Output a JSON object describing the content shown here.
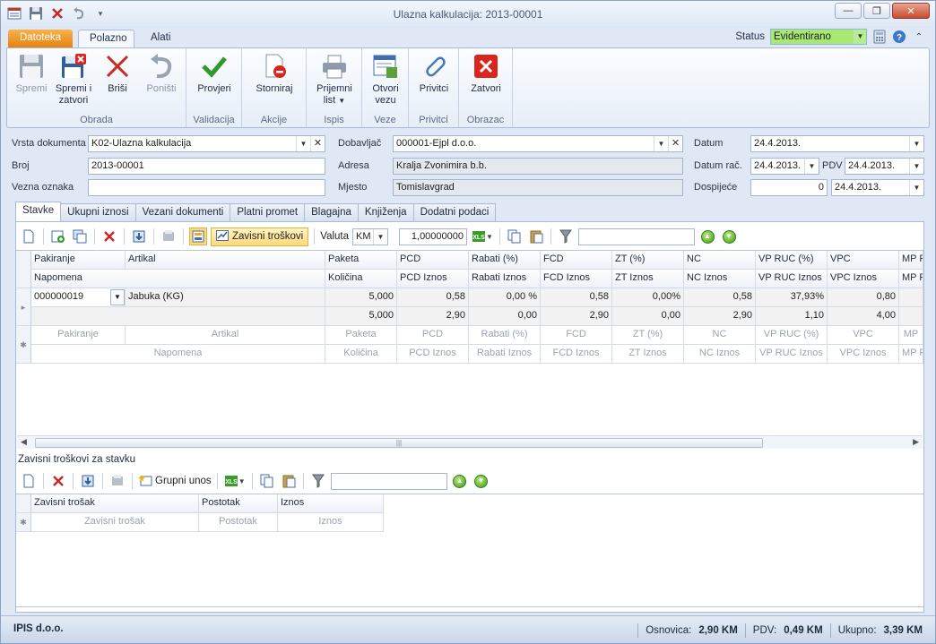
{
  "window": {
    "title": "Ulazna kalkulacija: 2013-00001"
  },
  "ribbon": {
    "tabs": {
      "file": "Datoteka",
      "home": "Polazno",
      "tools": "Alati"
    },
    "status": {
      "label": "Status",
      "value": "Evidentirano"
    },
    "groups": {
      "obrada": {
        "label": "Obrada",
        "spremi": "Spremi",
        "spremi_zatvori_1": "Spremi i",
        "spremi_zatvori_2": "zatvori",
        "brisi": "Briši",
        "ponisti": "Poništi"
      },
      "validacija": {
        "label": "Validacija",
        "provjeri": "Provjeri"
      },
      "akcije": {
        "label": "Akcije",
        "storniraj": "Storniraj"
      },
      "ispis": {
        "label": "Ispis",
        "prijemni_1": "Prijemni",
        "prijemni_2": "list"
      },
      "veze": {
        "label": "Veze",
        "otvori_1": "Otvori",
        "otvori_2": "vezu"
      },
      "privitci": {
        "label": "Privitci",
        "privitci": "Privitci"
      },
      "obrazac": {
        "label": "Obrazac",
        "zatvori": "Zatvori"
      }
    }
  },
  "form": {
    "vrsta_label": "Vrsta dokumenta",
    "vrsta_value": "K02-Ulazna kalkulacija",
    "broj_label": "Broj",
    "broj_value": "2013-00001",
    "vezna_label": "Vezna oznaka",
    "vezna_value": "",
    "dobavljac_label": "Dobavljač",
    "dobavljac_value": "000001-Ejpl d.o.o.",
    "adresa_label": "Adresa",
    "adresa_value": "Kralja Zvonimira b.b.",
    "mjesto_label": "Mjesto",
    "mjesto_value": "Tomislavgrad",
    "datum_label": "Datum",
    "datum_value": "24.4.2013.",
    "datum_rac_label": "Datum rač.",
    "datum_rac_value": "24.4.2013.",
    "pdv_label": "PDV",
    "pdv_value": "24.4.2013.",
    "dospijece_label": "Dospijeće",
    "dospijece_days": "0",
    "dospijece_value": "24.4.2013."
  },
  "page_tabs": [
    "Stavke",
    "Ukupni iznosi",
    "Vezani dokumenti",
    "Platni promet",
    "Blagajna",
    "Knjiženja",
    "Dodatni podaci"
  ],
  "toolbar": {
    "zavisni": "Zavisni troškovi",
    "valuta_label": "Valuta",
    "valuta_value": "KM",
    "tecaj": "1,00000000"
  },
  "grid": {
    "header1": [
      "Pakiranje",
      "Artikal",
      "Paketa",
      "PCD",
      "Rabati (%)",
      "FCD",
      "ZT (%)",
      "NC",
      "VP RUC (%)",
      "VPC",
      "MP R"
    ],
    "header2": [
      "Napomena",
      "Količina",
      "PCD Iznos",
      "Rabati Iznos",
      "FCD Iznos",
      "ZT Iznos",
      "NC Iznos",
      "VP RUC Iznos",
      "VPC Iznos",
      "MP R"
    ],
    "row1": [
      "000000019",
      "Jabuka (KG)",
      "5,000",
      "0,58",
      "0,00 %",
      "0,58",
      "0,00%",
      "0,58",
      "37,93%",
      "0,80",
      ""
    ],
    "row2": [
      "",
      "5,000",
      "2,90",
      "0,00",
      "2,90",
      "0,00",
      "2,90",
      "1,10",
      "4,00",
      ""
    ],
    "new1": [
      "Pakiranje",
      "Artikal",
      "Paketa",
      "PCD",
      "Rabati (%)",
      "FCD",
      "ZT (%)",
      "NC",
      "VP RUC (%)",
      "VPC",
      "MP"
    ],
    "new2": [
      "Napomena",
      "Količina",
      "PCD Iznos",
      "Rabati Iznos",
      "FCD Iznos",
      "ZT Iznos",
      "NC Iznos",
      "VP RUC Iznos",
      "VPC Iznos",
      "MP R"
    ]
  },
  "sub": {
    "title": "Zavisni troškovi za stavku",
    "grupni": "Grupni unos",
    "headers": [
      "Zavisni trošak",
      "Postotak",
      "Iznos"
    ],
    "new_row": [
      "Zavisni trošak",
      "Postotak",
      "Iznos"
    ]
  },
  "statusbar": {
    "company": "IPIS d.o.o.",
    "osnovica_label": "Osnovica:",
    "osnovica_value": "2,90 KM",
    "pdv_label": "PDV:",
    "pdv_value": "0,49 KM",
    "ukupno_label": "Ukupno:",
    "ukupno_value": "3,39 KM"
  }
}
